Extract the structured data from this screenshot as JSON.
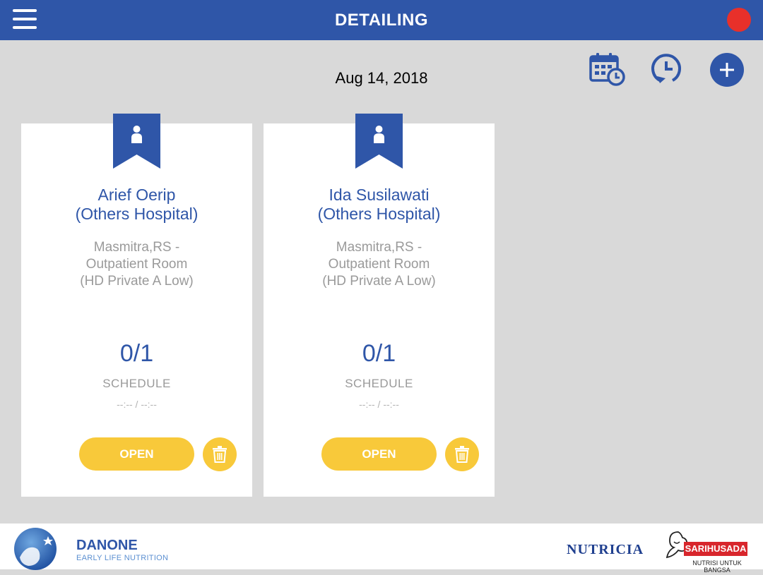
{
  "app": {
    "title": "DETAILING"
  },
  "colors": {
    "primary": "#2f56a8",
    "accent": "#f8c93a",
    "status": "#e8302a"
  },
  "header": {
    "menu_icon": "hamburger-icon",
    "status_indicator": "red-dot"
  },
  "toolbar": {
    "date": "Aug 14, 2018",
    "icons": [
      "calendar-clock-icon",
      "history-icon",
      "add-icon"
    ]
  },
  "cards": [
    {
      "name": "Arief Oerip",
      "hospital": "(Others Hospital)",
      "location_1": "Masmitra,RS -",
      "location_2": "Outpatient Room",
      "location_3": "(HD Private A Low)",
      "count": "0/1",
      "schedule_label": "SCHEDULE",
      "time": "--:-- / --:--",
      "open_label": "OPEN"
    },
    {
      "name": "Ida Susilawati",
      "hospital": "(Others Hospital)",
      "location_1": "Masmitra,RS -",
      "location_2": "Outpatient Room",
      "location_3": "(HD Private A Low)",
      "count": "0/1",
      "schedule_label": "SCHEDULE",
      "time": "--:-- / --:--",
      "open_label": "OPEN"
    }
  ],
  "footer": {
    "danone_brand": "DANONE",
    "danone_sub": "EARLY LIFE NUTRITION",
    "nutricia": "NUTRICIA",
    "sarihusada": "SARIHUSADA",
    "sarihusada_sub": "NUTRISI UNTUK BANGSA"
  }
}
